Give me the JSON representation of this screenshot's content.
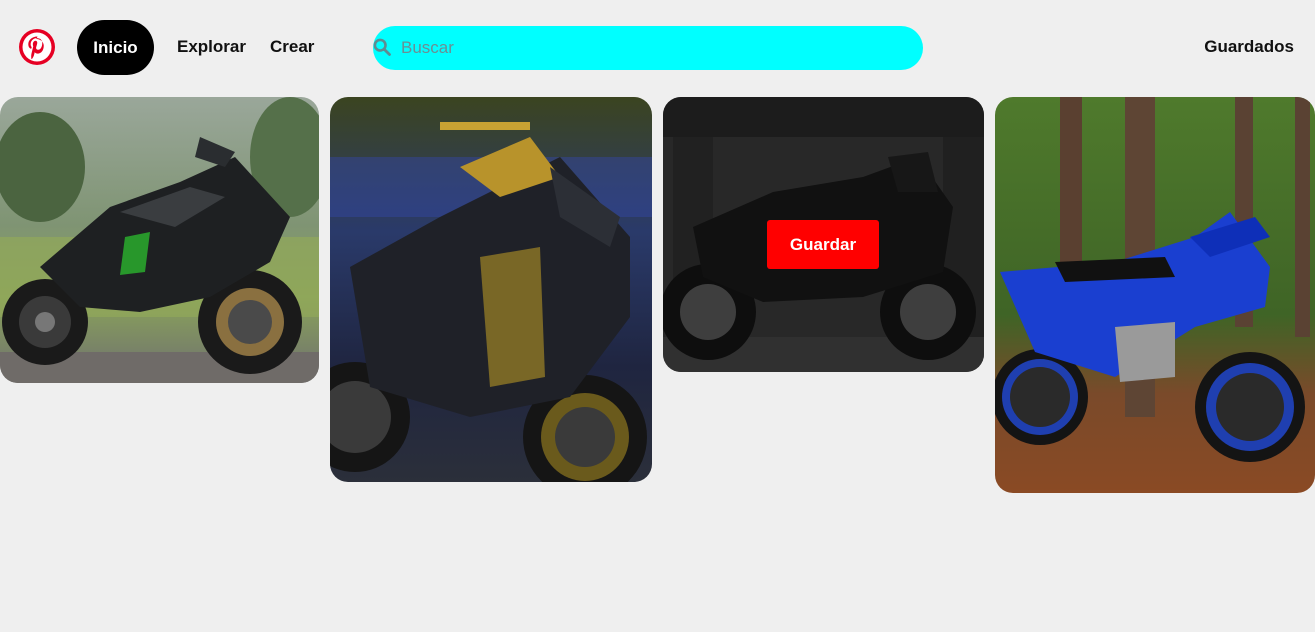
{
  "header": {
    "logo_icon": "pinterest-logo-icon",
    "nav": {
      "home_label": "Inicio",
      "explore_label": "Explorar",
      "create_label": "Crear"
    },
    "search": {
      "placeholder": "Buscar",
      "value": "",
      "icon": "search-icon",
      "background": "#00ffff"
    },
    "saved_label": "Guardados"
  },
  "colors": {
    "brand": "#e60023",
    "save_button": "#ff0000",
    "active_nav": "#000000",
    "search": "#00ffff"
  },
  "pins": [
    {
      "image": "motorcycle-photo",
      "description": "black and green sport motorcycle parked on a path by trees",
      "hovered": false
    },
    {
      "image": "motorcycle-photo",
      "description": "black and gold Kawasaki naked motorcycle at night",
      "hovered": false
    },
    {
      "image": "motorcycle-photo",
      "description": "dark motorcycle parked in a garage",
      "hovered": true,
      "save_label": "Guardar"
    },
    {
      "image": "motorcycle-photo",
      "description": "blue Yamaha dirt bike in a forest",
      "hovered": false
    }
  ]
}
